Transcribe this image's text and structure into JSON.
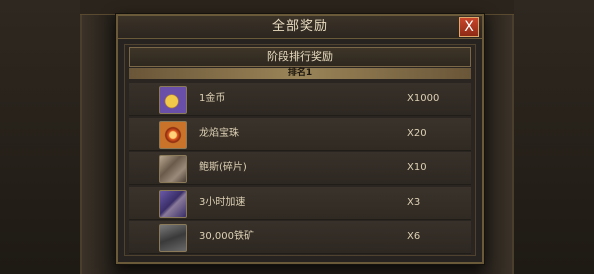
{
  "dialog": {
    "title": "全部奖励",
    "close_label": "X"
  },
  "stage": {
    "title": "阶段排行奖励",
    "rank_label": "排名1"
  },
  "rewards": [
    {
      "name": "1金币",
      "quantity": "X1000",
      "icon": "gold-coin-icon",
      "color": "#6a4fa8"
    },
    {
      "name": "龙焰宝珠",
      "quantity": "X20",
      "icon": "dragon-flame-orb-icon",
      "color": "#c8722a"
    },
    {
      "name": "鲍斯(碎片)",
      "quantity": "X10",
      "icon": "character-fragment-icon",
      "color": "#8a7a6a"
    },
    {
      "name": "3小时加速",
      "quantity": "X3",
      "icon": "speedup-icon",
      "color": "#5a4a8a"
    },
    {
      "name": "30,000铁矿",
      "quantity": "X6",
      "icon": "iron-ore-icon",
      "color": "#4a4a4a"
    }
  ]
}
